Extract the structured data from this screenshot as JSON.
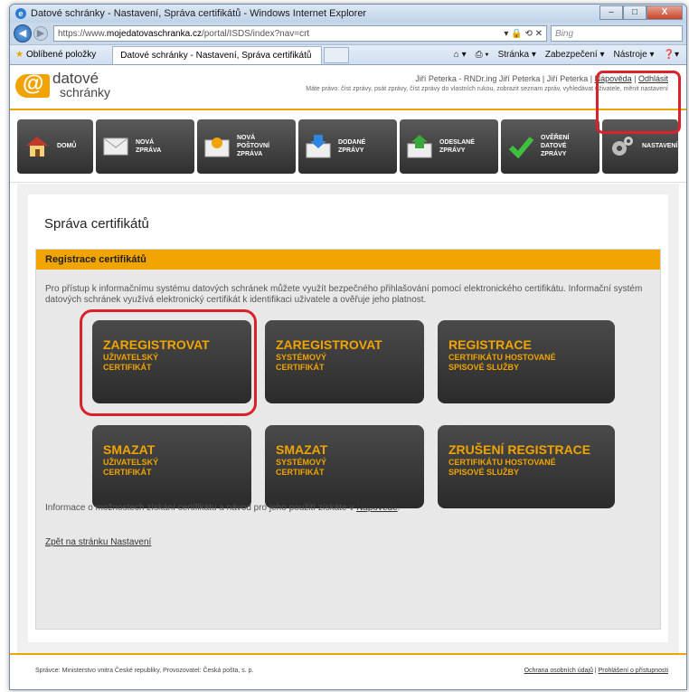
{
  "window": {
    "title": "Datové schránky - Nastavení, Správa certifikátů - Windows Internet Explorer",
    "controls": [
      "–",
      "□",
      "X"
    ]
  },
  "address_bar": {
    "url_prefix": "https://www.",
    "url_domain": "mojedatovaschranka.cz",
    "url_path": "/portal/ISDS/index?nav=crt",
    "search_placeholder": "Bing"
  },
  "favorites_bar": {
    "favorites_label": "Oblíbené položky",
    "tab_title": "Datové schránky - Nastavení, Správa certifikátů",
    "commands": [
      "Stránka ▾",
      "Zabezpečení ▾",
      "Nástroje ▾"
    ]
  },
  "header": {
    "logo_line1": "datové",
    "logo_line2": "schránky",
    "user_text": "Jiří Peterka - RNDr.ing Jiří Peterka | Jiří Peterka |",
    "help_link": "Nápověda",
    "logout_link": "Odhlásit",
    "rights": "Máte právo: číst zprávy, psát zprávy, číst zprávy do vlastních rukou, zobrazit seznam zpráv, vyhledávat uživatele, měnit nastavení"
  },
  "menu": [
    {
      "label": "DOMŮ"
    },
    {
      "label": "NOVÁ\nZPRÁVA"
    },
    {
      "label": "NOVÁ\nPOŠTOVNÍ\nZPRÁVA"
    },
    {
      "label": "DODANÉ\nZPRÁVY"
    },
    {
      "label": "ODESLANÉ\nZPRÁVY"
    },
    {
      "label": "OVĚŘENÍ\nDATOVÉ\nZPRÁVY"
    },
    {
      "label": "NASTAVENÍ"
    }
  ],
  "page": {
    "title": "Správa certifikátů",
    "panel_title": "Registrace certifikátů",
    "intro": "Pro přístup k informačnímu systému datových schránek můžete využít bezpečného přihlašování pomocí elektronického certifikátu. Informační systém datových schránek využívá elektronický certifikát k identifikaci uživatele a ověřuje jeho platnost.",
    "buttons": [
      {
        "head": "ZAREGISTROVAT",
        "sub": "UŽIVATELSKÝ\nCERTIFIKÁT"
      },
      {
        "head": "ZAREGISTROVAT",
        "sub": "SYSTÉMOVÝ\nCERTIFIKÁT"
      },
      {
        "head": "REGISTRACE",
        "sub": "CERTIFIKÁTU HOSTOVANÉ\nSPISOVÉ SLUŽBY"
      },
      {
        "head": "SMAZAT",
        "sub": "UŽIVATELSKÝ\nCERTIFIKÁT"
      },
      {
        "head": "SMAZAT",
        "sub": "SYSTÉMOVÝ\nCERTIFIKÁT"
      },
      {
        "head": "ZRUŠENÍ REGISTRACE",
        "sub": "CERTIFIKÁTU HOSTOVANÉ\nSPISOVÉ SLUŽBY"
      }
    ],
    "info_text": "Informace o možnostech získání certifikátu a návod pro jeho použití získáte v",
    "info_link": "Nápovědě",
    "back_link": "Zpět na stránku Nastavení"
  },
  "footer": {
    "left": "Správce: Ministerstvo vnitra České republiky, Provozovatel: Česká pošta, s. p.",
    "privacy": "Ochrana osobních údajů",
    "accessibility": "Prohlášení o přístupnosti"
  },
  "colors": {
    "accent": "#f1a300",
    "highlight_ring": "#d9222a",
    "button_dark": "#2f2f2f"
  }
}
